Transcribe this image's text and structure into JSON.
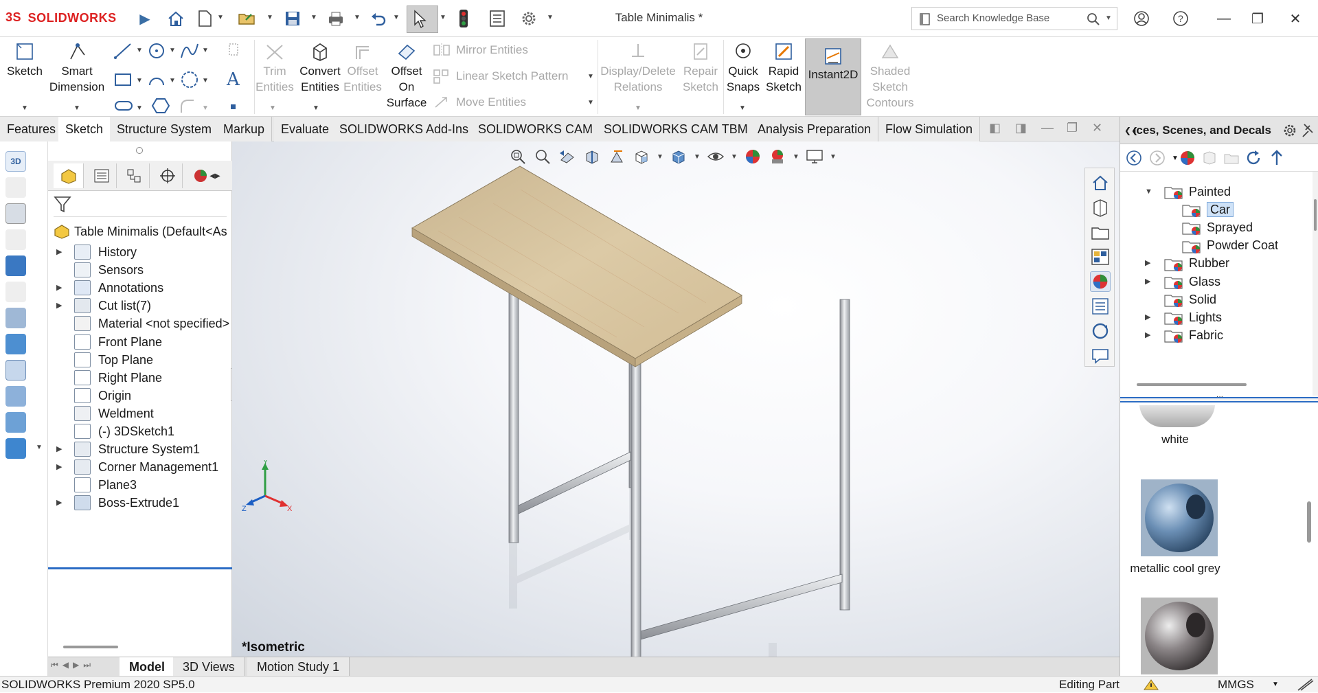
{
  "app": {
    "logo": "SOLIDWORKS",
    "doc_title": "Table Minimalis *",
    "search_placeholder": "Search Knowledge Base"
  },
  "ribbon": {
    "sketch": "Sketch",
    "smart_dimension_1": "Smart",
    "smart_dimension_2": "Dimension",
    "trim_1": "Trim",
    "trim_2": "Entities",
    "convert_1": "Convert",
    "convert_2": "Entities",
    "offset_1": "Offset",
    "offset_2": "Entities",
    "offset_surface_1": "Offset",
    "offset_surface_2": "On",
    "offset_surface_3": "Surface",
    "mirror": "Mirror Entities",
    "linear_pattern": "Linear Sketch Pattern",
    "move": "Move Entities",
    "display_delete_1": "Display/Delete",
    "display_delete_2": "Relations",
    "repair_1": "Repair",
    "repair_2": "Sketch",
    "quick_snaps_1": "Quick",
    "quick_snaps_2": "Snaps",
    "rapid_1": "Rapid",
    "rapid_2": "Sketch",
    "instant2d": "Instant2D",
    "shaded_1": "Shaded",
    "shaded_2": "Sketch",
    "shaded_3": "Contours"
  },
  "command_tabs": [
    "Features",
    "Sketch",
    "Structure System",
    "Markup",
    "Evaluate",
    "SOLIDWORKS Add-Ins",
    "SOLIDWORKS CAM",
    "SOLIDWORKS CAM TBM",
    "Analysis Preparation",
    "Flow Simulation"
  ],
  "active_tab": "Sketch",
  "feature_tree": {
    "root": "Table Minimalis  (Default<As",
    "items": [
      {
        "label": "History",
        "expandable": true
      },
      {
        "label": "Sensors",
        "expandable": false
      },
      {
        "label": "Annotations",
        "expandable": true
      },
      {
        "label": "Cut list(7)",
        "expandable": true
      },
      {
        "label": "Material <not specified>",
        "expandable": false
      },
      {
        "label": "Front Plane",
        "expandable": false
      },
      {
        "label": "Top Plane",
        "expandable": false
      },
      {
        "label": "Right Plane",
        "expandable": false
      },
      {
        "label": "Origin",
        "expandable": false
      },
      {
        "label": "Weldment",
        "expandable": false
      },
      {
        "label": "(-) 3DSketch1",
        "expandable": false
      },
      {
        "label": "Structure System1",
        "expandable": true
      },
      {
        "label": "Corner Management1",
        "expandable": true
      },
      {
        "label": "Plane3",
        "expandable": false
      },
      {
        "label": "Boss-Extrude1",
        "expandable": true
      }
    ]
  },
  "viewport": {
    "view_label": "*Isometric",
    "triad": {
      "x": "X",
      "y": "Y",
      "z": "Z"
    }
  },
  "bottom_tabs": [
    "Model",
    "3D Views",
    "Motion Study 1"
  ],
  "active_bottom_tab": "Model",
  "status": {
    "product": "SOLIDWORKS Premium 2020 SP5.0",
    "mode": "Editing Part",
    "units": "MMGS"
  },
  "task_pane": {
    "title": "Appearances, Scenes, and Decals",
    "tree": [
      {
        "label": "Painted",
        "level": 1,
        "expanded": true
      },
      {
        "label": "Car",
        "level": 2,
        "selected": true
      },
      {
        "label": "Sprayed",
        "level": 2
      },
      {
        "label": "Powder Coat",
        "level": 2
      },
      {
        "label": "Rubber",
        "level": 1,
        "expandable": true
      },
      {
        "label": "Glass",
        "level": 1,
        "expandable": true
      },
      {
        "label": "Solid",
        "level": 1
      },
      {
        "label": "Lights",
        "level": 1,
        "expandable": true
      },
      {
        "label": "Fabric",
        "level": 1,
        "expandable": true
      }
    ],
    "swatches": [
      "white",
      "metallic cool grey"
    ]
  },
  "colors": {
    "brand_red": "#d22222",
    "selection_blue": "#2b6cc4",
    "wood_top": "#d8c7a3",
    "metal_leg": "#b9bcc1"
  }
}
